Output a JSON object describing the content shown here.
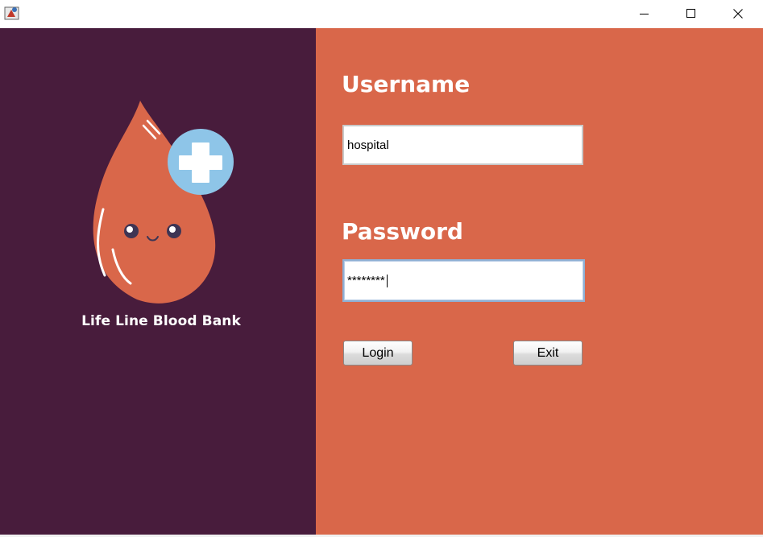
{
  "window": {
    "icon": "java-app-icon",
    "minimize_icon": "minimize-icon",
    "maximize_icon": "maximize-icon",
    "close_icon": "close-icon"
  },
  "brand": {
    "name": "Life Line Blood Bank",
    "logo": "blood-drop-logo"
  },
  "form": {
    "username_label": "Username",
    "username_value": "hospital",
    "password_label": "Password",
    "password_value": "********",
    "login_label": "Login",
    "exit_label": "Exit"
  },
  "colors": {
    "left_panel": "#481C3C",
    "right_panel": "#D9674A",
    "drop": "#D9674A",
    "cross_badge": "#8EC5E8"
  }
}
